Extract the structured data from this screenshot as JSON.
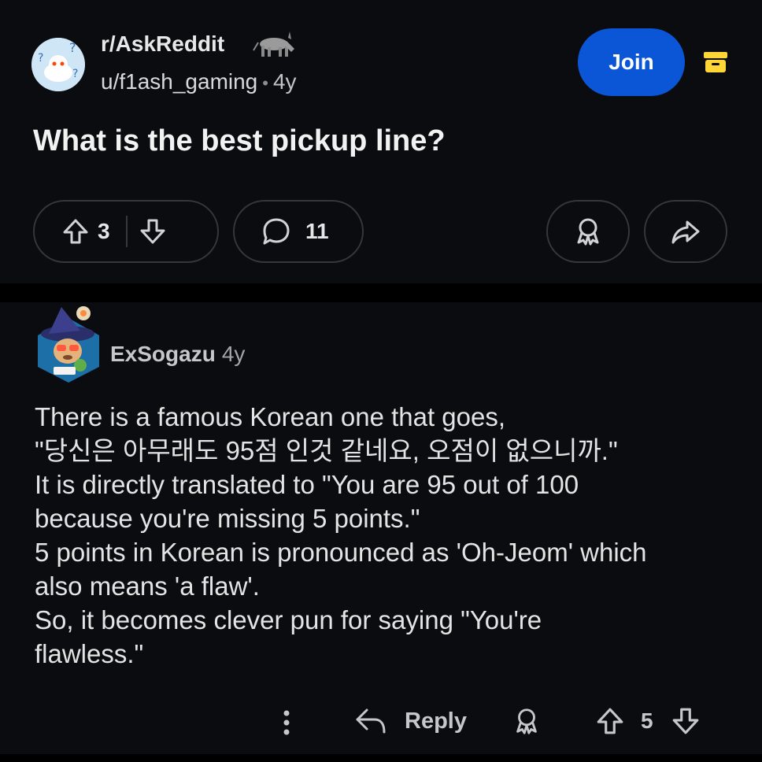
{
  "post": {
    "subreddit": "r/AskReddit",
    "author": "u/f1ash_gaming",
    "separator": "•",
    "age": "4y",
    "join_label": "Join",
    "title": "What is the best pickup line?",
    "upvotes": "3",
    "comments": "11"
  },
  "comment": {
    "author": "ExSogazu",
    "age": "4y",
    "lines": [
      "There is a famous Korean one that goes,",
      "\"당신은 아무래도 95점 인것 같네요, 오점이 없으니까.\"",
      "It is directly translated to \"You are 95 out of 100",
      "because you're missing 5 points.\"",
      "5 points in Korean is pronounced as 'Oh-Jeom' which",
      "also means 'a flaw'.",
      "So, it becomes clever pun for saying \"You're",
      "flawless.\""
    ],
    "reply_label": "Reply",
    "score": "5"
  },
  "colors": {
    "background": "#0b0c0f",
    "join_button": "#0a56d6",
    "archive_icon": "#ffd635",
    "pill_border": "#34373c"
  },
  "icons": [
    "subreddit-avatar",
    "donkey-icon",
    "archive-icon",
    "upvote-icon",
    "downvote-icon",
    "comment-icon",
    "award-icon",
    "share-icon",
    "user-avatar",
    "more-icon",
    "reply-icon"
  ]
}
